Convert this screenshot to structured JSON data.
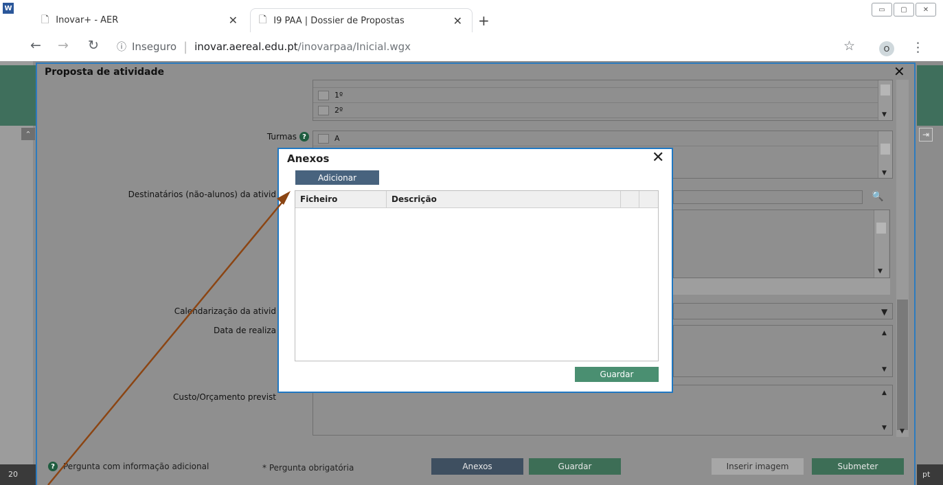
{
  "browser": {
    "tabs": [
      {
        "label": "Inovar+ - AER"
      },
      {
        "label": "I9 PAA | Dossier de Propostas"
      }
    ],
    "address": {
      "security": "Inseguro",
      "host": "inovar.aereal.edu.pt",
      "path": "/inovarpaa/Inicial.wgx"
    },
    "profile_initial": "O"
  },
  "background": {
    "footer_left": "20",
    "footer_right": "pt"
  },
  "main_dialog": {
    "title": "Proposta de atividade",
    "year_rows": [
      "1º",
      "2º"
    ],
    "turmas_label": "Turmas",
    "turmas_rows": [
      "A"
    ],
    "destinatarios_label": "Destinatários (não-alunos) da ativid",
    "calendarizacao_label": "Calendarização da ativid",
    "data_label": "Data de realiza",
    "custo_label": "Custo/Orçamento previst",
    "footer": {
      "help_text": "Pergunta com informação adicional",
      "required_text": "* Pergunta obrigatória",
      "anexos_label": "Anexos",
      "guardar_label": "Guardar",
      "inserir_label": "Inserir imagem",
      "submeter_label": "Submeter"
    }
  },
  "anexos_modal": {
    "title": "Anexos",
    "add_label": "Adicionar",
    "columns": [
      "Ficheiro",
      "Descrição"
    ],
    "rows": [],
    "save_label": "Guardar"
  },
  "colors": {
    "modal_border": "#1f77c2",
    "add_button": "#48637e",
    "save_button": "#4a8f71",
    "annotation_arrow": "#8b4513"
  }
}
